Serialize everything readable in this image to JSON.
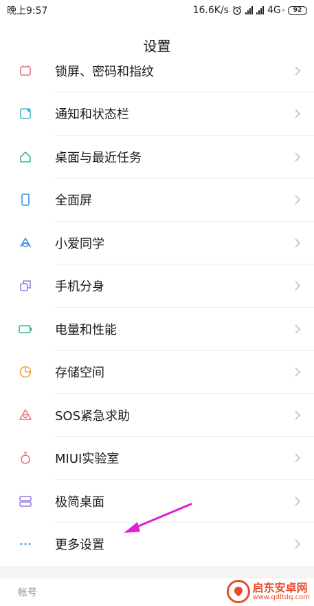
{
  "status_bar": {
    "time": "晚上9:57",
    "speed": "16.6K/s",
    "network": "4G",
    "network_sup": "ᵍ",
    "battery": "92"
  },
  "title": "设置",
  "items": [
    {
      "label": "锁屏、密码和指纹",
      "icon": "lock-screen-icon",
      "color": "#e8747c"
    },
    {
      "label": "通知和状态栏",
      "icon": "notification-icon",
      "color": "#3fb8c9"
    },
    {
      "label": "桌面与最近任务",
      "icon": "home-icon",
      "color": "#35b7a0"
    },
    {
      "label": "全面屏",
      "icon": "fullscreen-icon",
      "color": "#3a8fe8"
    },
    {
      "label": "小爱同学",
      "icon": "xiaoai-icon",
      "color": "#3a8fe8"
    },
    {
      "label": "手机分身",
      "icon": "second-space-icon",
      "color": "#9a7be0"
    },
    {
      "label": "电量和性能",
      "icon": "battery-icon",
      "color": "#35b77a"
    },
    {
      "label": "存储空间",
      "icon": "storage-icon",
      "color": "#f0a040"
    },
    {
      "label": "SOS紧急求助",
      "icon": "sos-icon",
      "color": "#e8747c"
    },
    {
      "label": "MIUI实验室",
      "icon": "lab-icon",
      "color": "#e8747c"
    },
    {
      "label": "极简桌面",
      "icon": "minimal-desktop-icon",
      "color": "#9a7be0"
    },
    {
      "label": "更多设置",
      "icon": "more-icon",
      "color": "#3a8fe8"
    }
  ],
  "section_account": "帐号",
  "watermark": {
    "name": "启东安卓网",
    "url": "www.qdltdq.com"
  },
  "accent_arrow_color": "#e020d0"
}
